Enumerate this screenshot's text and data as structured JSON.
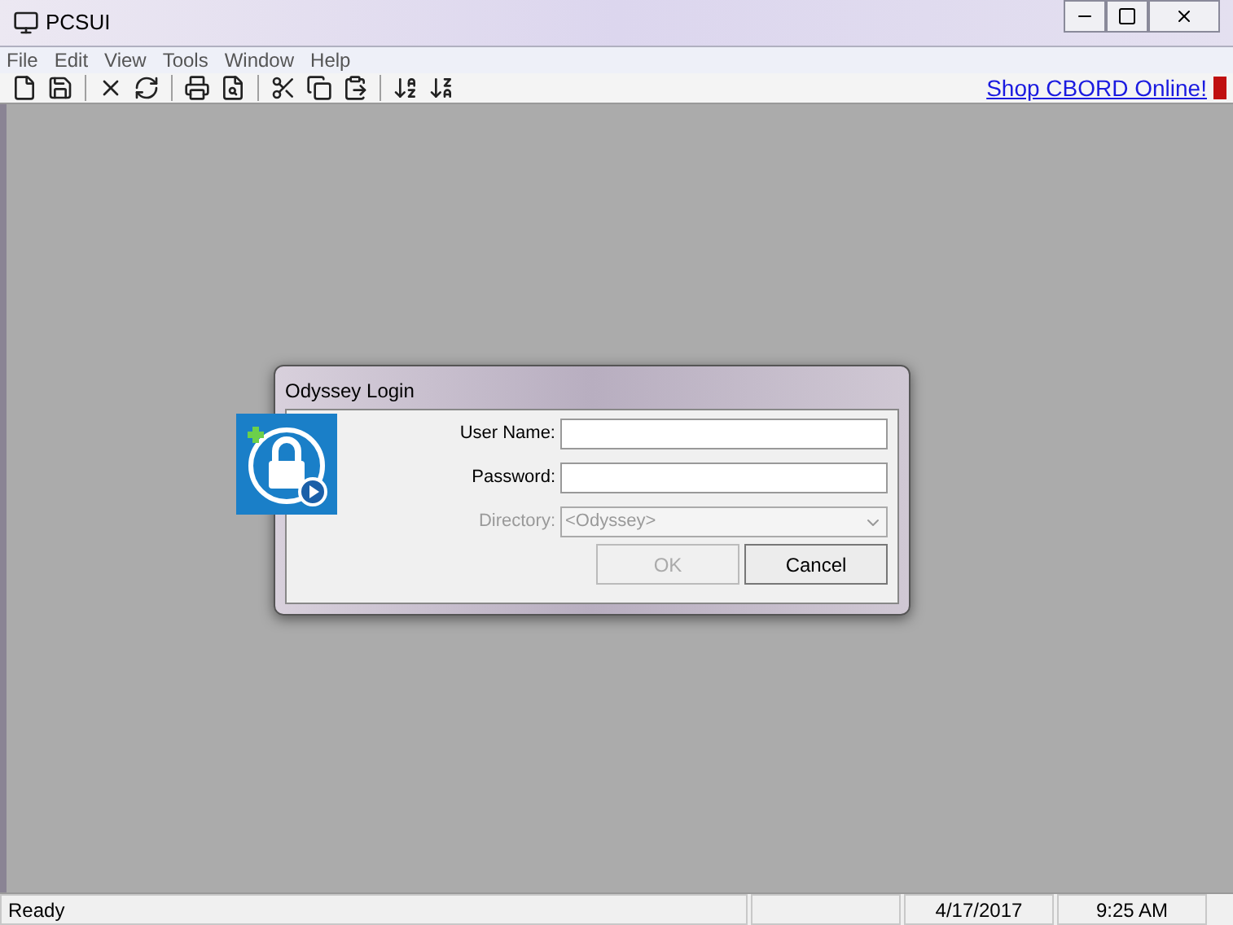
{
  "window": {
    "title": "PCSUI"
  },
  "menu": [
    "File",
    "Edit",
    "View",
    "Tools",
    "Window",
    "Help"
  ],
  "toolbar": {
    "link": "Shop CBORD Online!"
  },
  "dialog": {
    "title": "Odyssey Login",
    "fields": [
      {
        "kind": "text",
        "label": "User Name:"
      },
      {
        "kind": "text",
        "label": "Password:"
      },
      {
        "kind": "select",
        "label": "Directory:",
        "value": "<Odyssey>",
        "disabled": true
      }
    ],
    "buttons": [
      {
        "label": "OK",
        "disabled": true
      },
      {
        "label": "Cancel",
        "disabled": false
      }
    ]
  },
  "status_bar": {
    "message": "Ready",
    "date": "4/17/2017",
    "time": "9:25 AM"
  }
}
